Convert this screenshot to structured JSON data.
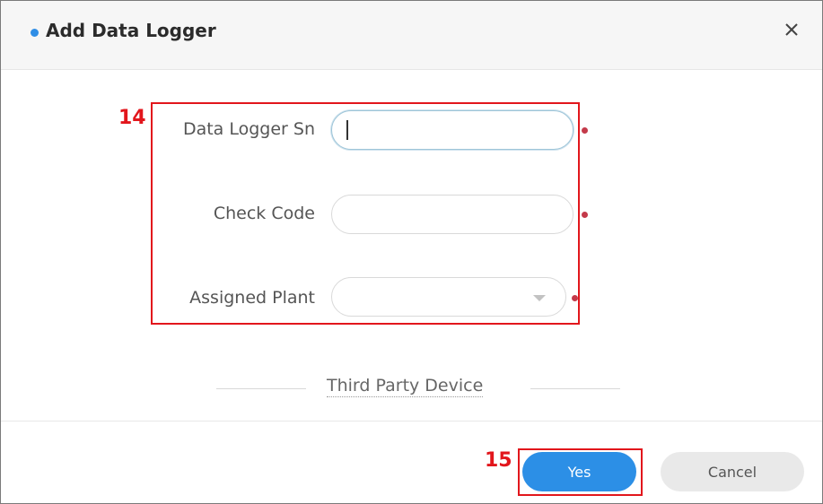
{
  "dialog": {
    "title": "Add Data Logger",
    "close_icon": "close-icon"
  },
  "form": {
    "sn_label": "Data Logger Sn",
    "sn_value": "",
    "check_code_label": "Check Code",
    "check_code_value": "",
    "plant_label": "Assigned Plant",
    "plant_value": ""
  },
  "third_party_link": "Third Party Device",
  "footer": {
    "yes_label": "Yes",
    "cancel_label": "Cancel"
  },
  "annotations": {
    "form_box_number": "14",
    "yes_box_number": "15"
  },
  "colors": {
    "accent": "#2c8fe6",
    "required": "#c43a4a",
    "annotation": "#e2161c"
  }
}
